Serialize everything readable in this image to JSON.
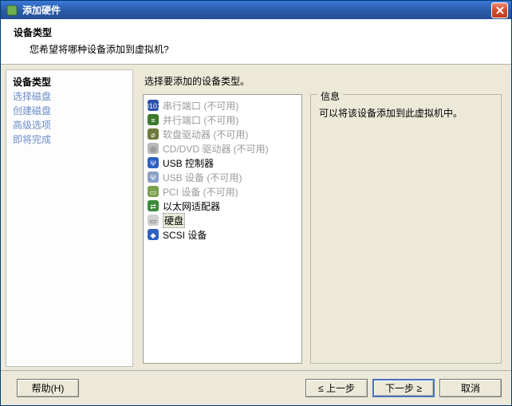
{
  "window": {
    "title": "添加硬件"
  },
  "header": {
    "heading": "设备类型",
    "subheading": "您希望将哪种设备添加到虚拟机?"
  },
  "sidebar": {
    "steps": [
      {
        "label": "设备类型",
        "active": true
      },
      {
        "label": "选择磁盘",
        "active": false
      },
      {
        "label": "创建磁盘",
        "active": false
      },
      {
        "label": "高级选项",
        "active": false
      },
      {
        "label": "即将完成",
        "active": false
      }
    ]
  },
  "main": {
    "instruction": "选择要添加的设备类型。",
    "devices": [
      {
        "name": "serial-port",
        "label": "串行端口 (不可用)",
        "enabled": false,
        "selected": false,
        "icon": "serial-port-icon"
      },
      {
        "name": "parallel-port",
        "label": "并行端口 (不可用)",
        "enabled": false,
        "selected": false,
        "icon": "parallel-port-icon"
      },
      {
        "name": "floppy-drive",
        "label": "软盘驱动器 (不可用)",
        "enabled": false,
        "selected": false,
        "icon": "floppy-drive-icon"
      },
      {
        "name": "cd-dvd-drive",
        "label": "CD/DVD 驱动器 (不可用)",
        "enabled": false,
        "selected": false,
        "icon": "cd-dvd-icon"
      },
      {
        "name": "usb-controller",
        "label": "USB 控制器",
        "enabled": true,
        "selected": false,
        "icon": "usb-controller-icon"
      },
      {
        "name": "usb-device",
        "label": "USB 设备 (不可用)",
        "enabled": false,
        "selected": false,
        "icon": "usb-device-icon"
      },
      {
        "name": "pci-device",
        "label": "PCI 设备 (不可用)",
        "enabled": false,
        "selected": false,
        "icon": "pci-device-icon"
      },
      {
        "name": "ethernet-adapter",
        "label": "以太网适配器",
        "enabled": true,
        "selected": false,
        "icon": "ethernet-icon"
      },
      {
        "name": "hard-disk",
        "label": "硬盘",
        "enabled": true,
        "selected": true,
        "icon": "hard-disk-icon"
      },
      {
        "name": "scsi-device",
        "label": "SCSI 设备",
        "enabled": true,
        "selected": false,
        "icon": "scsi-device-icon"
      }
    ],
    "info": {
      "legend": "信息",
      "text": "可以将该设备添加到此虚拟机中。"
    }
  },
  "footer": {
    "help": "帮助(H)",
    "back": "≤ 上一步",
    "next": "下一步 ≥",
    "cancel": "取消"
  },
  "icons": {
    "serial-port-icon": {
      "bg": "#2a4fa8",
      "fg": "#ffffff",
      "glyph": "0101"
    },
    "parallel-port-icon": {
      "bg": "#3a7a2a",
      "fg": "#ffffff",
      "glyph": "≡"
    },
    "floppy-drive-icon": {
      "bg": "#6b7a3a",
      "fg": "#ffffff",
      "glyph": "⌀"
    },
    "cd-dvd-icon": {
      "bg": "#b8b8b8",
      "fg": "#555555",
      "glyph": "◎"
    },
    "usb-controller-icon": {
      "bg": "#3060c0",
      "fg": "#ffffff",
      "glyph": "Ψ"
    },
    "usb-device-icon": {
      "bg": "#8aa0c8",
      "fg": "#ffffff",
      "glyph": "Ψ"
    },
    "pci-device-icon": {
      "bg": "#7aa050",
      "fg": "#ffffff",
      "glyph": "▭"
    },
    "ethernet-icon": {
      "bg": "#3a8a3a",
      "fg": "#ffffff",
      "glyph": "⇄"
    },
    "hard-disk-icon": {
      "bg": "#d0d0d0",
      "fg": "#555555",
      "glyph": "▭"
    },
    "scsi-device-icon": {
      "bg": "#3060c0",
      "fg": "#ffffff",
      "glyph": "◆"
    }
  }
}
